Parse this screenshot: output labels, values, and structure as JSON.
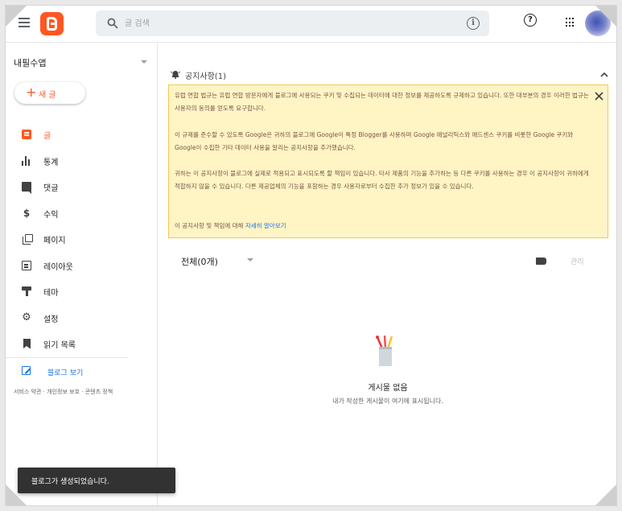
{
  "header": {
    "search_placeholder": "글 검색",
    "help_glyph": "?",
    "info_glyph": "i"
  },
  "sidebar": {
    "blog_name": "내필수앱",
    "new_post_label": "새 글",
    "items": [
      {
        "label": "글",
        "icon": "posts-icon"
      },
      {
        "label": "통계",
        "icon": "stats-icon"
      },
      {
        "label": "댓글",
        "icon": "comments-icon"
      },
      {
        "label": "수익",
        "icon": "earnings-icon"
      },
      {
        "label": "페이지",
        "icon": "pages-icon"
      },
      {
        "label": "레이아웃",
        "icon": "layout-icon"
      },
      {
        "label": "테마",
        "icon": "theme-icon"
      },
      {
        "label": "설정",
        "icon": "settings-icon"
      },
      {
        "label": "읽기 목록",
        "icon": "reading-list-icon"
      }
    ],
    "view_blog_label": "블로그 보기",
    "footer": {
      "terms": "서비스 약관",
      "privacy": "개인정보 보호",
      "content_policy": "콘텐츠 정책",
      "separator": "·"
    }
  },
  "notice": {
    "title": "공지사항(1)",
    "p1": "유럽 연합 법규는 유럽 연합 방문자에게 블로그에 사용되는 쿠키 및 수집되는 데이터에 대한 정보를 제공하도록 규제하고 있습니다. 또한 대부분의 경우 이러한 법규는 사용자의 동의를 얻도록 요구합니다.",
    "p2": "이 규제를 준수할 수 있도록 Google은 귀하의 블로그에 Google이 특정 Blogger를 사용하며 Google 애널리틱스와 애드센스 쿠키를 비롯한 Google 쿠키와 Google이 수집한 기타 데이터 사용을 알리는 공지사항을 추가했습니다.",
    "p3": "귀하는 이 공지사항이 블로그에 실제로 적용되고 표시되도록 할 책임이 있습니다. 타사 제품의 기능을 추가하는 등 다른 쿠키를 사용하는 경우 이 공지사항이 귀하에게 적합하지 않을 수 있습니다. 다른 제공업체의 기능을 포함하는 경우 사용자로부터 수집한 추가 정보가 있을 수 있습니다.",
    "p4_prefix": "이 공지사항 및 책임에 대해 ",
    "p4_link": "자세히 알아보기"
  },
  "posts": {
    "filter_label": "전체(0개)",
    "manage_label": "관리",
    "empty_title": "게시물 없음",
    "empty_subtitle": "내가 작성한 게시물이 여기에 표시됩니다."
  },
  "toast": {
    "message": "블로그가 생성되었습니다."
  },
  "colors": {
    "accent": "#ff5722",
    "link": "#1a73e8",
    "notice_bg": "#fff4c4",
    "notice_border": "#f4c94c",
    "toast_bg": "#323232"
  }
}
